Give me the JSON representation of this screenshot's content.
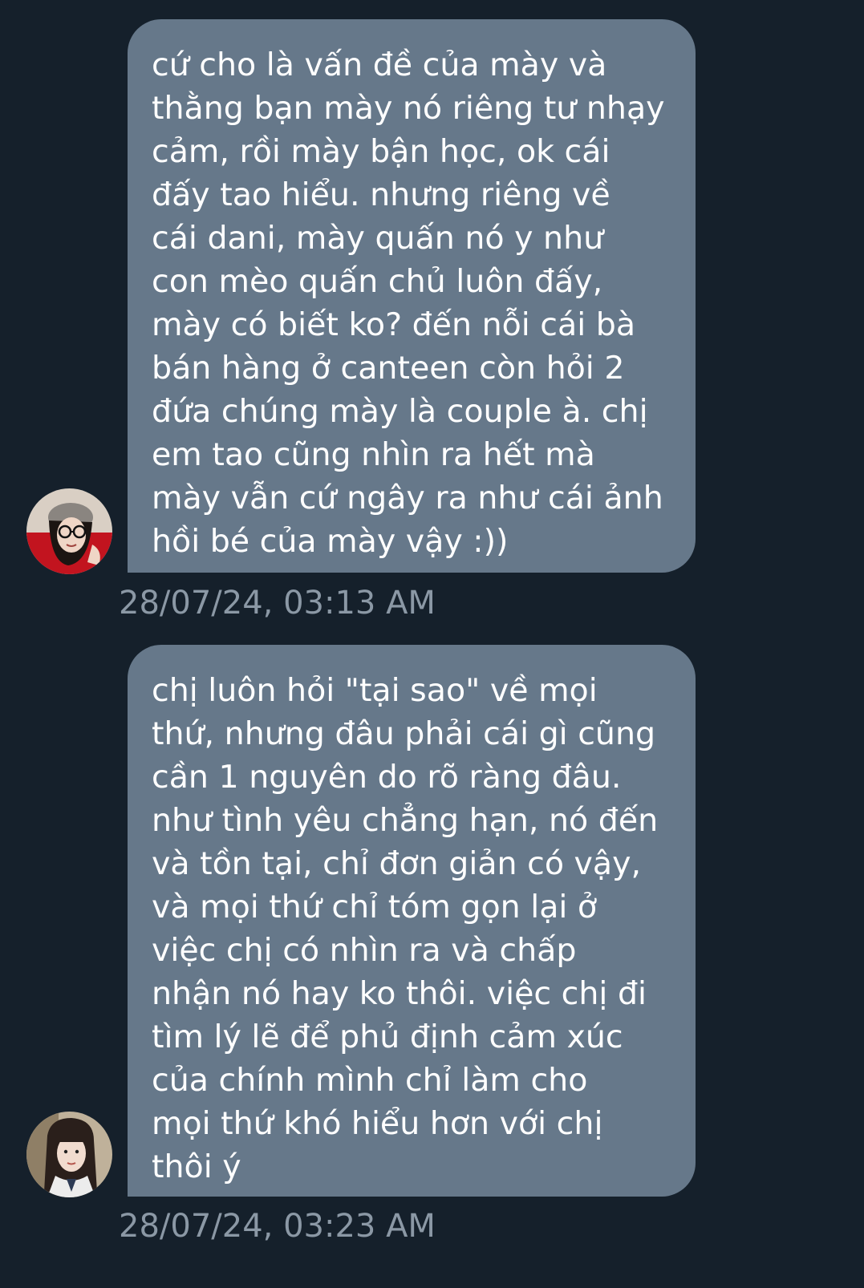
{
  "messages": [
    {
      "text": "cứ cho là vấn đề của mày và\nthằng bạn mày nó riêng tư nhạy\ncảm, rồi mày bận học, ok cái\nđấy tao hiểu. nhưng riêng về\ncái dani, mày quấn nó y như\ncon mèo quấn chủ luôn đấy,\nmày có biết ko? đến nỗi cái bà\nbán hàng ở canteen còn hỏi 2\nđứa chúng mày là couple à. chị\nem tao cũng nhìn ra hết mà\nmày vẫn cứ ngây ra như cái ảnh\nhồi bé của mày vậy :))",
      "timestamp": "28/07/24, 03:13 AM"
    },
    {
      "text": "chị luôn hỏi \"tại sao\" về mọi\nthứ, nhưng đâu phải cái gì cũng\ncần 1 nguyên do rõ ràng đâu.\nnhư tình yêu chẳng hạn, nó đến\nvà tồn tại, chỉ đơn giản có vậy,\nvà mọi thứ chỉ tóm gọn lại ở\nviệc chị có nhìn ra và chấp\nnhận nó hay ko thôi. việc chị đi\ntìm lý lẽ để phủ định cảm xúc\ncủa chính mình chỉ làm cho\nmọi thứ khó hiểu hơn với chị\nthôi ý",
      "timestamp": "28/07/24, 03:23 AM"
    }
  ],
  "colors": {
    "background": "#15202b",
    "bubble": "#66788a",
    "text": "#ffffff",
    "timestamp": "#8b98a5"
  }
}
